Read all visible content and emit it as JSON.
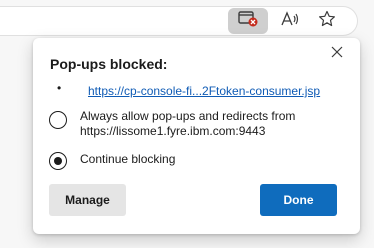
{
  "toolbar": {
    "icons": [
      "popup-blocked-icon",
      "read-aloud-icon",
      "favorite-star-icon"
    ],
    "read_aloud_glyph": "A⁾"
  },
  "popup": {
    "title": "Pop-ups blocked:",
    "bullet": "•",
    "blocked_link": "https://cp-console-fi...2Ftoken-consumer.jsp",
    "options": [
      {
        "line1": "Always allow pop-ups and redirects from",
        "line2": "https://lissome1.fyre.ibm.com:9443",
        "selected": false
      },
      {
        "line1": "Continue blocking",
        "selected": true
      }
    ],
    "manage_label": "Manage",
    "done_label": "Done"
  },
  "colors": {
    "accent": "#0f6cbd",
    "link": "#0f5bb5",
    "badge": "#c42b1c"
  }
}
